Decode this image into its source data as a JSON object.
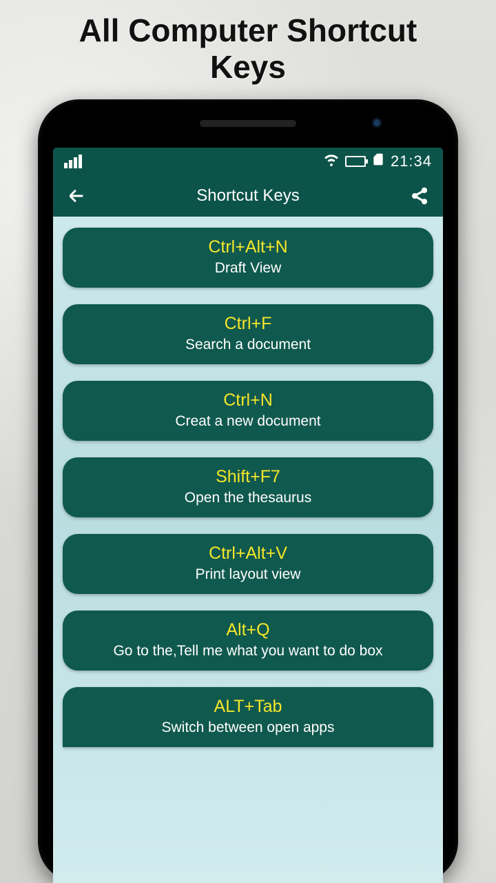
{
  "page": {
    "title_line1": "All Computer Shortcut",
    "title_line2": "Keys"
  },
  "status": {
    "time": "21:34"
  },
  "appbar": {
    "title": "Shortcut Keys"
  },
  "shortcuts": [
    {
      "key": "Ctrl+Alt+N",
      "desc": "Draft View"
    },
    {
      "key": "Ctrl+F",
      "desc": "Search a document"
    },
    {
      "key": "Ctrl+N",
      "desc": "Creat a new document"
    },
    {
      "key": "Shift+F7",
      "desc": "Open the thesaurus"
    },
    {
      "key": "Ctrl+Alt+V",
      "desc": "Print layout view"
    },
    {
      "key": "Alt+Q",
      "desc": "Go to the,Tell me what you want to do box"
    },
    {
      "key": "ALT+Tab",
      "desc": "Switch between open apps"
    }
  ]
}
